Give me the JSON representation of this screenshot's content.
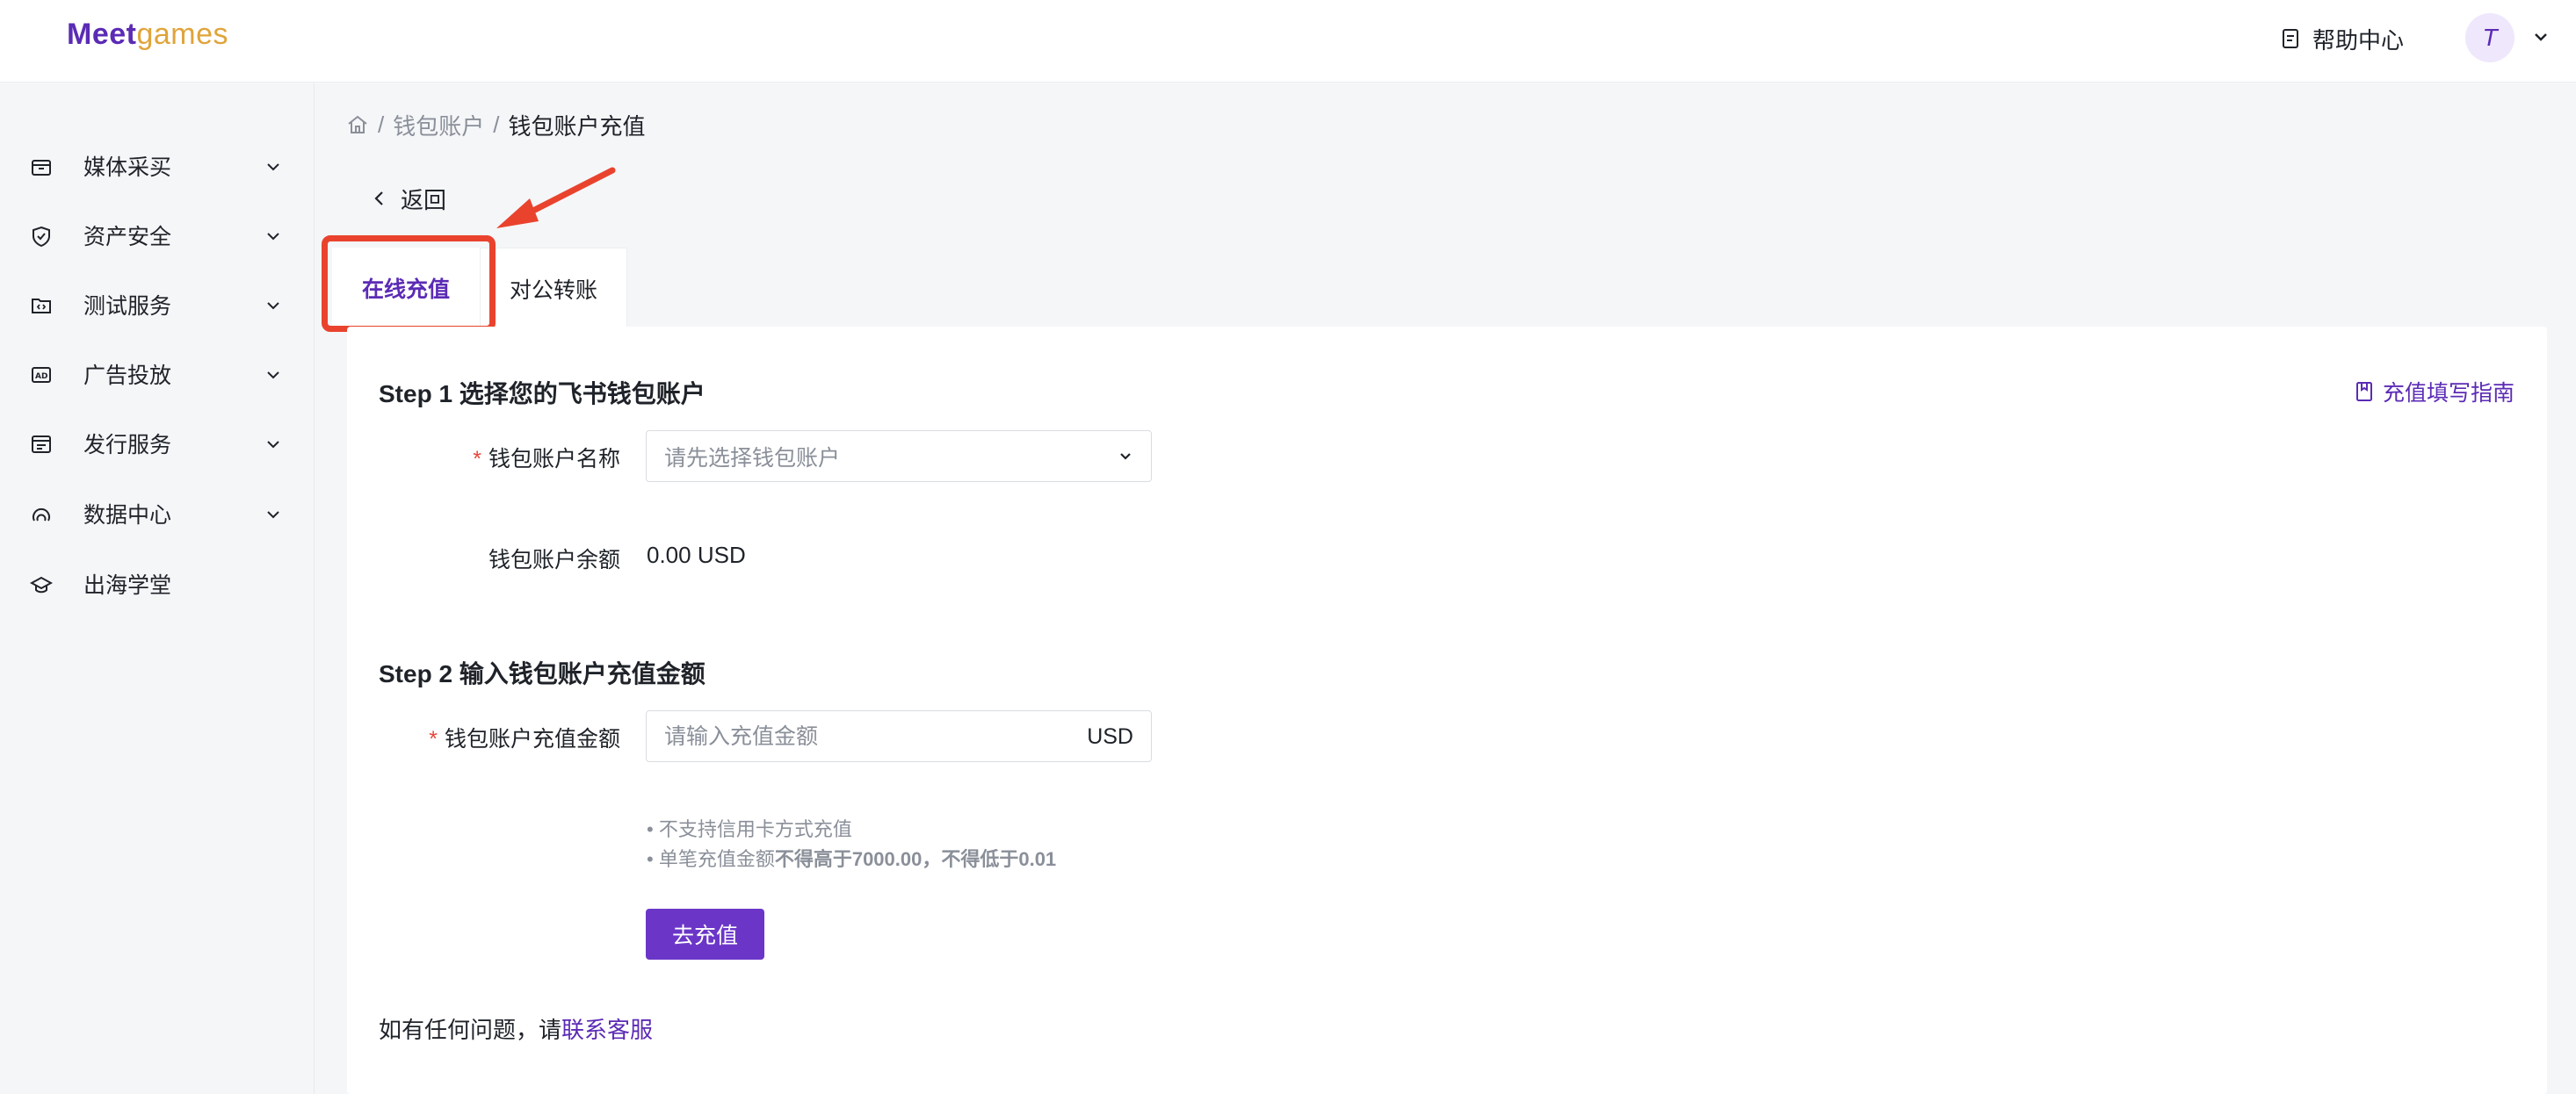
{
  "header": {
    "logo_part1": "Meet",
    "logo_part2": "games",
    "help_label": "帮助中心",
    "avatar_initial": "T"
  },
  "sidebar": {
    "items": [
      {
        "label": "媒体采买",
        "icon": "cart-icon",
        "expandable": true
      },
      {
        "label": "资产安全",
        "icon": "shield-icon",
        "expandable": true
      },
      {
        "label": "测试服务",
        "icon": "folder-code-icon",
        "expandable": true
      },
      {
        "label": "广告投放",
        "icon": "ad-icon",
        "expandable": true
      },
      {
        "label": "发行服务",
        "icon": "publish-icon",
        "expandable": true
      },
      {
        "label": "数据中心",
        "icon": "data-icon",
        "expandable": true
      },
      {
        "label": "出海学堂",
        "icon": "graduation-cap-icon",
        "expandable": false
      }
    ]
  },
  "breadcrumb": {
    "items": [
      "钱包账户",
      "钱包账户充值"
    ]
  },
  "back_label": "返回",
  "tabs": [
    {
      "label": "在线充值",
      "active": true
    },
    {
      "label": "对公转账",
      "active": false
    }
  ],
  "step1": {
    "title": "Step 1 选择您的飞书钱包账户",
    "guide_link": "充值填写指南",
    "account_label": "钱包账户名称",
    "account_placeholder": "请先选择钱包账户",
    "balance_label": "钱包账户余额",
    "balance_value": "0.00 USD"
  },
  "step2": {
    "title": "Step 2 输入钱包账户充值金额",
    "amount_label": "钱包账户充值金额",
    "amount_placeholder": "请输入充值金额",
    "amount_value": "",
    "amount_unit": "USD",
    "hint1": "• 不支持信用卡方式充值",
    "hint2_prefix": "• 单笔充值金额",
    "hint2_bold": "不得高于7000.00，不得低于0.01",
    "submit_label": "去充值"
  },
  "contact": {
    "prefix": "如有任何问题，请",
    "link": "联系客服"
  },
  "colors": {
    "brand": "#5b2bb5",
    "button": "#6b36c8",
    "highlight": "#e9432e",
    "required": "#e5483b"
  }
}
